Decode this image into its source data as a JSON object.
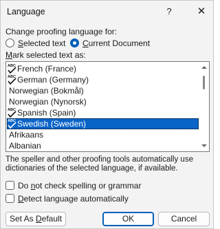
{
  "window": {
    "title": "Language",
    "help_label": "?",
    "close_label": "✕"
  },
  "proofing": {
    "heading": "Change proofing language for:",
    "options": [
      {
        "label": "Selected text",
        "checked": false
      },
      {
        "label": "Current Document",
        "checked": true
      }
    ]
  },
  "languages": {
    "label": "Mark selected text as:",
    "items": [
      {
        "label": "French (France)",
        "spell_icon": true,
        "selected": false
      },
      {
        "label": "German (Germany)",
        "spell_icon": true,
        "selected": false
      },
      {
        "label": "Norwegian (Bokmål)",
        "spell_icon": false,
        "selected": false
      },
      {
        "label": "Norwegian (Nynorsk)",
        "spell_icon": false,
        "selected": false
      },
      {
        "label": "Spanish (Spain)",
        "spell_icon": true,
        "selected": false
      },
      {
        "label": "Swedish (Sweden)",
        "spell_icon": true,
        "selected": true
      },
      {
        "label": "Afrikaans",
        "spell_icon": false,
        "selected": false
      },
      {
        "label": "Albanian",
        "spell_icon": false,
        "selected": false
      }
    ]
  },
  "info": {
    "text": "The speller and other proofing tools automatically use dictionaries of the selected language, if available."
  },
  "checks": {
    "no_spelling": {
      "label_pre": "Do ",
      "label_u": "n",
      "label_post": "ot check spelling or grammar",
      "checked": false
    },
    "detect": {
      "label_u": "D",
      "label_post": "etect language automatically",
      "checked": false
    }
  },
  "buttons": {
    "set_default": "Set As Default",
    "ok": "OK",
    "cancel": "Cancel"
  },
  "colors": {
    "accent": "#005fb8",
    "selection": "#0a64c8"
  }
}
